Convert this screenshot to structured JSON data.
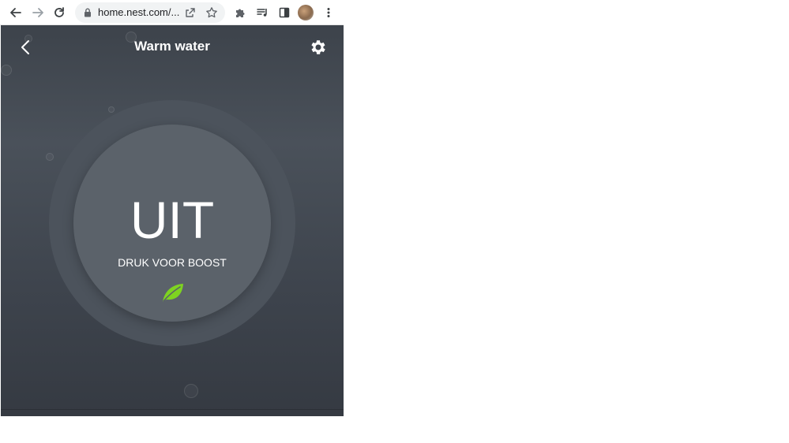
{
  "browser": {
    "url": "home.nest.com/...",
    "icons": {
      "back": "arrow-left-icon",
      "forward": "arrow-right-icon",
      "reload": "reload-icon",
      "lock": "lock-icon",
      "share": "share-icon",
      "bookmark": "star-icon",
      "extensions": "puzzle-icon",
      "media": "media-queue-icon",
      "sidepanel": "side-panel-icon",
      "menu": "kebab-menu-icon"
    }
  },
  "app": {
    "title": "Warm water",
    "state": "UIT",
    "boost_label": "DRUK VOOR BOOST",
    "colors": {
      "background": "#3d434b",
      "ring": "#4c535c",
      "disc": "#5b626a",
      "leaf": "#7ed321",
      "text": "#ffffff"
    },
    "icons": {
      "back": "chevron-left-icon",
      "settings": "gear-icon",
      "eco": "leaf-icon"
    }
  }
}
